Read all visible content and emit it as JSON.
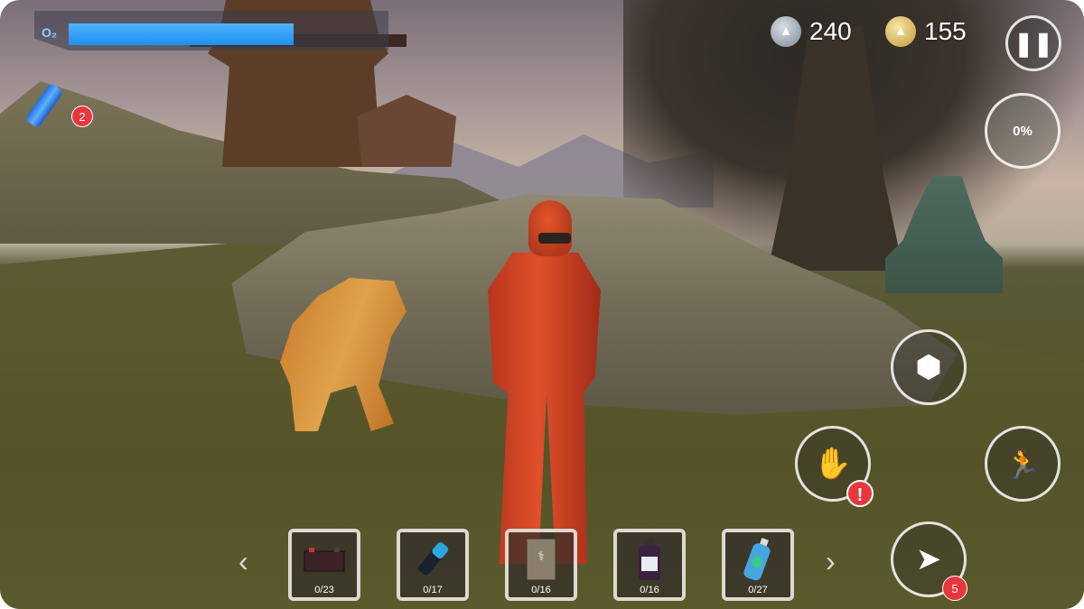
{
  "hud": {
    "oxygen_label": "O₂",
    "oxygen_level": 0.72,
    "bottle_count": "2",
    "silver_coins": "240",
    "gold_coins": "155",
    "silver_coin_icon": "▲",
    "gold_coin_icon": "▲",
    "pause_icon": "❚❚",
    "axe_progress": "0%",
    "nav_count": "5",
    "alert_mark": "!"
  },
  "buttons": {
    "block_icon": "⬢",
    "hand_icon": "✋",
    "run_icon": "🏃",
    "nav_icon": "➤"
  },
  "inventory": {
    "prev_icon": "‹",
    "next_icon": "›",
    "slots": [
      {
        "icon": "battery-box",
        "count": "0/23"
      },
      {
        "icon": "battery-cell",
        "count": "0/17"
      },
      {
        "icon": "manual-book",
        "count": "0/16"
      },
      {
        "icon": "medicine-bottle",
        "count": "0/16"
      },
      {
        "icon": "water-bottle",
        "count": "0/27"
      }
    ]
  },
  "colors": {
    "oxygen": "#2196f3",
    "badge": "#e8363d",
    "hero": "#d8482a"
  }
}
